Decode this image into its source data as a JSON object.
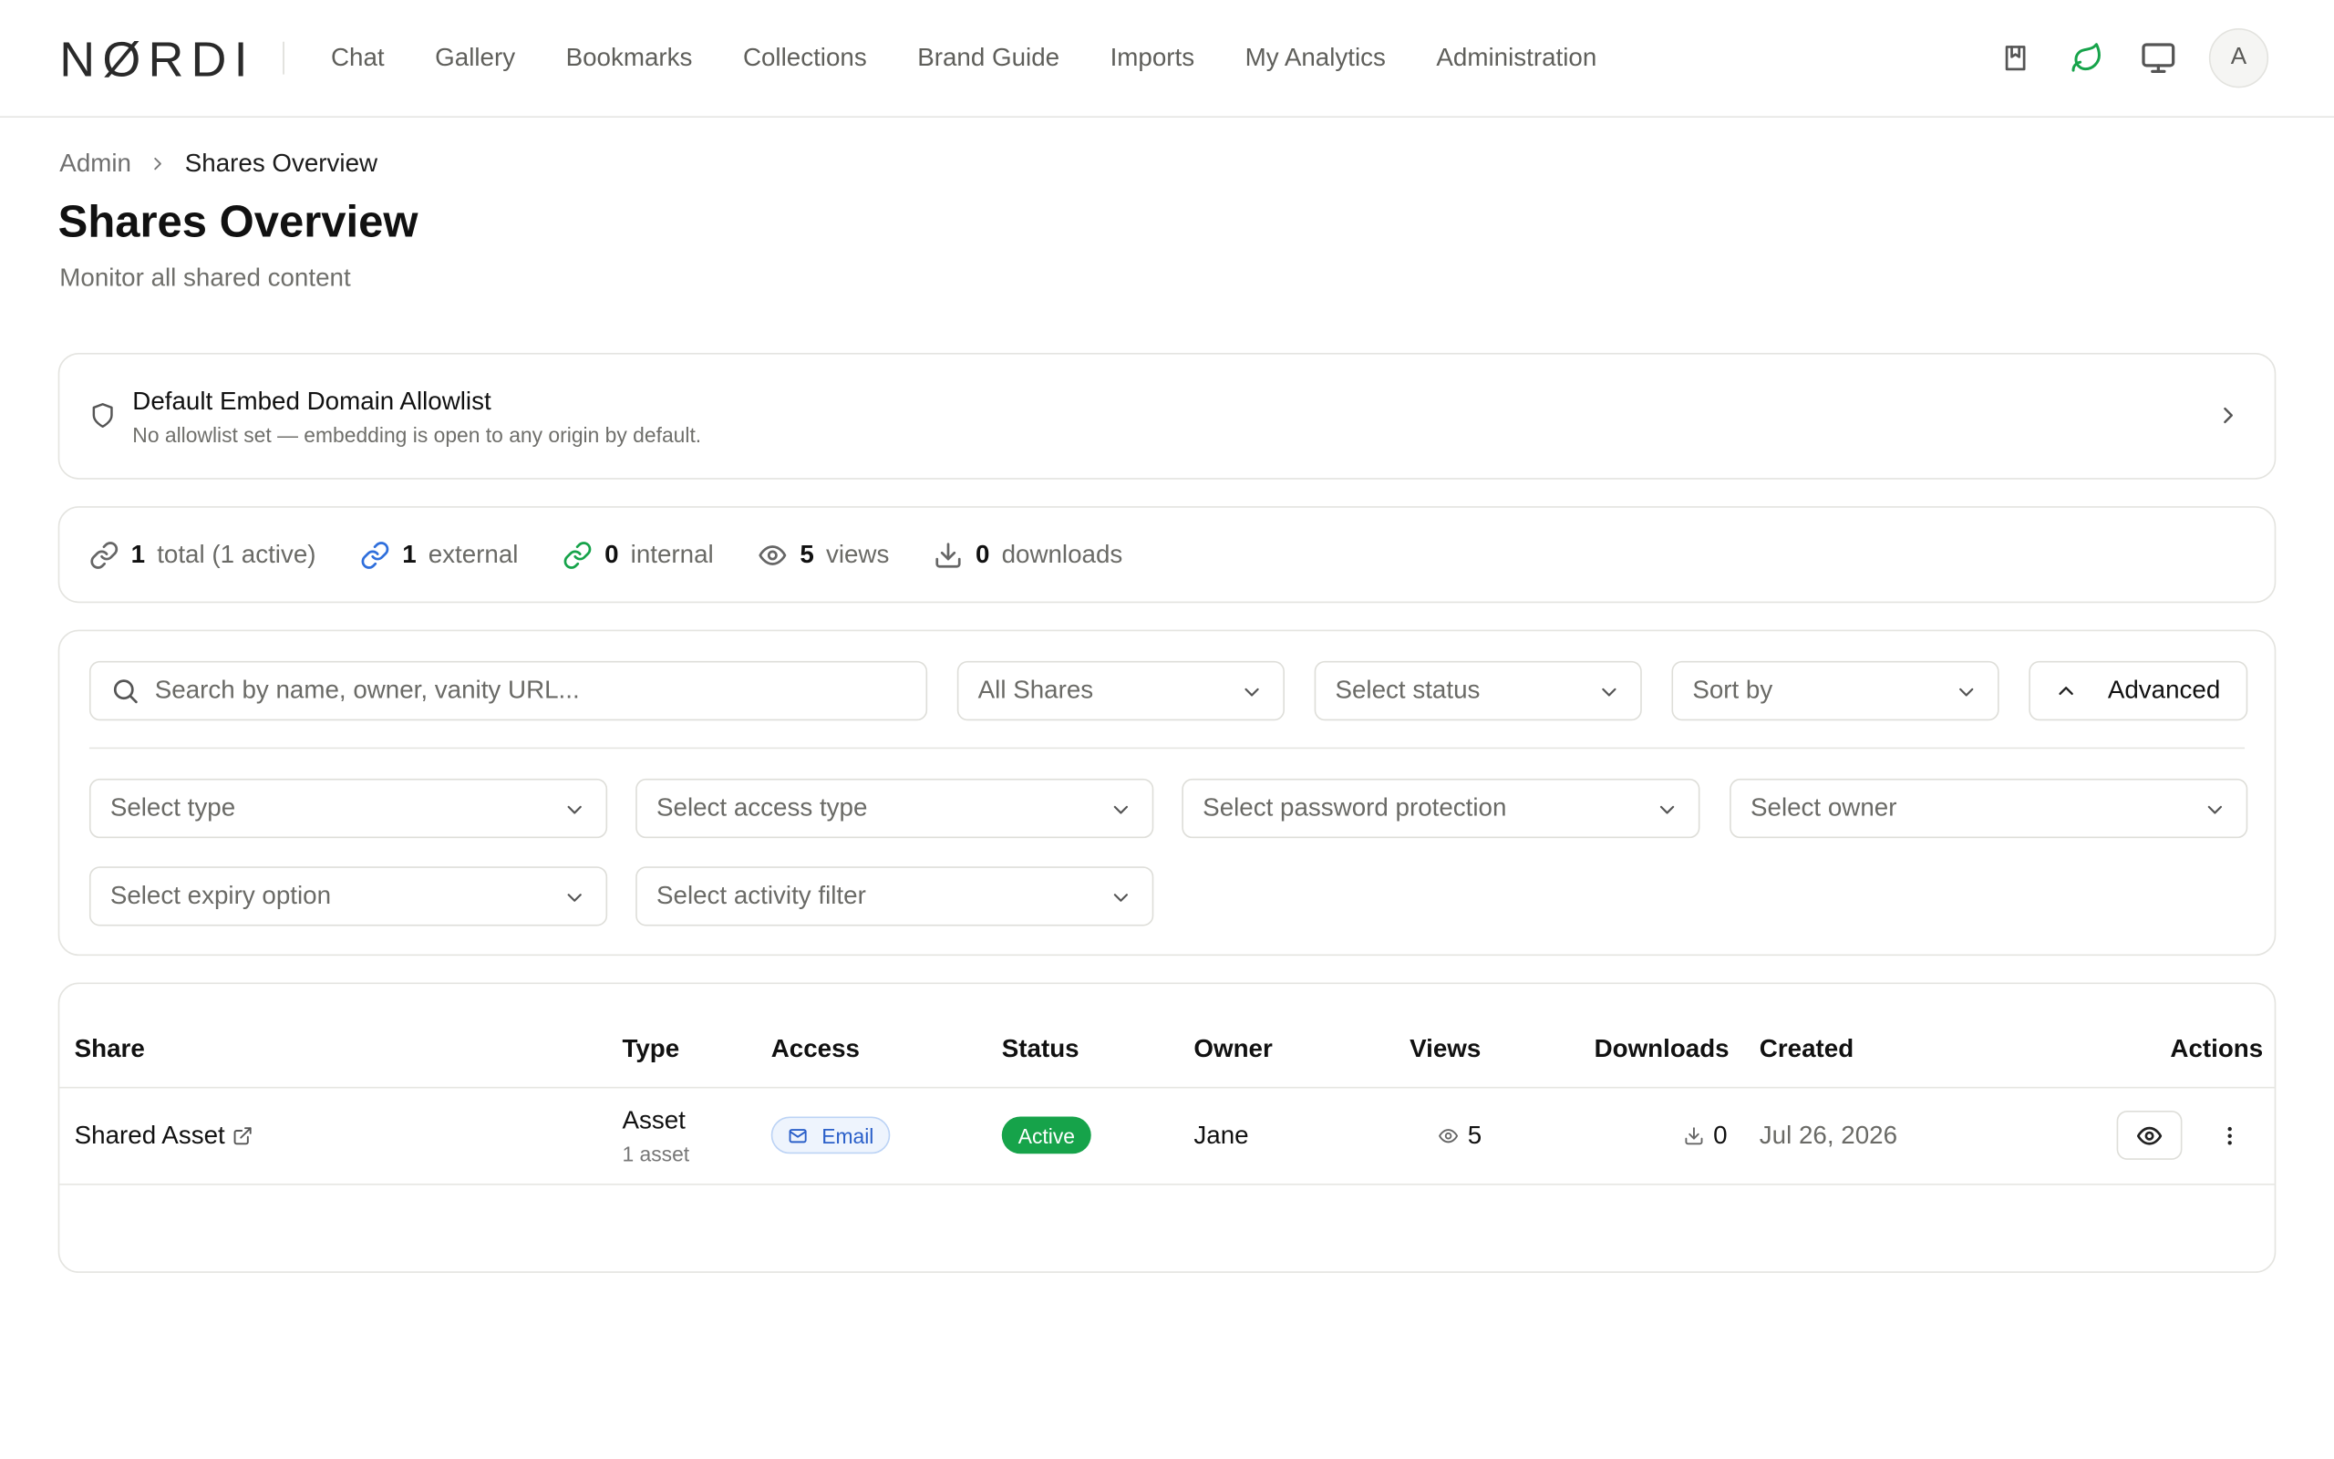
{
  "brand": {
    "logo": "NØRDI"
  },
  "nav": {
    "items": [
      "Chat",
      "Gallery",
      "Bookmarks",
      "Collections",
      "Brand Guide",
      "Imports",
      "My Analytics",
      "Administration"
    ]
  },
  "header": {
    "icons": [
      "bookmark-book-icon",
      "leaf-icon",
      "monitor-icon"
    ],
    "avatar_initial": "A",
    "accent_color": "#16a34a"
  },
  "breadcrumb": {
    "parent": "Admin",
    "current": "Shares Overview"
  },
  "page": {
    "title": "Shares Overview",
    "subtitle": "Monitor all shared content"
  },
  "allowlist": {
    "title": "Default Embed Domain Allowlist",
    "description": "No allowlist set — embedding is open to any origin by default."
  },
  "stats": {
    "total": {
      "value": "1",
      "label": "total (1 active)"
    },
    "external": {
      "value": "1",
      "label": "external"
    },
    "internal": {
      "value": "0",
      "label": "internal"
    },
    "views": {
      "value": "5",
      "label": "views"
    },
    "downloads": {
      "value": "0",
      "label": "downloads"
    }
  },
  "filters": {
    "search_placeholder": "Search by name, owner, vanity URL...",
    "shares_select": "All Shares",
    "status_select": "Select status",
    "sort_select": "Sort by",
    "advanced_label": "Advanced",
    "type_select": "Select type",
    "access_type_select": "Select access type",
    "password_select": "Select password protection",
    "owner_select": "Select owner",
    "expiry_select": "Select expiry option",
    "activity_select": "Select activity filter"
  },
  "table": {
    "columns": {
      "share": "Share",
      "type": "Type",
      "access": "Access",
      "status": "Status",
      "owner": "Owner",
      "views": "Views",
      "downloads": "Downloads",
      "created": "Created",
      "actions": "Actions"
    },
    "rows": [
      {
        "share": "Shared Asset",
        "type": "Asset",
        "type_sub": "1 asset",
        "access": "Email",
        "status": "Active",
        "owner": "Jane",
        "views": "5",
        "downloads": "0",
        "created": "Jul 26, 2026"
      }
    ]
  }
}
